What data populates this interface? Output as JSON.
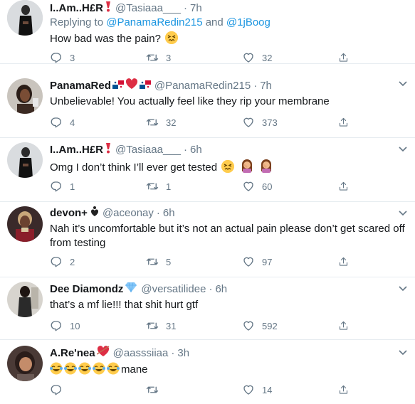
{
  "tweets": [
    {
      "name": "I..Am..H£R",
      "handle": "@Tasiaaa___",
      "time": "7h",
      "reply_prefix": "Replying to ",
      "reply_user1": "@PanamaRedin215",
      "reply_and": " and ",
      "reply_user2": "@1jBoog",
      "text": "How bad was the pain? ",
      "replies": "3",
      "retweets": "3",
      "likes": "32"
    },
    {
      "name": "PanamaRed",
      "handle": "@PanamaRedin215",
      "time": "7h",
      "text": "Unbelievable! You actually feel like they rip your membrane",
      "replies": "4",
      "retweets": "32",
      "likes": "373"
    },
    {
      "name": "I..Am..H£R",
      "handle": "@Tasiaaa___",
      "time": "6h",
      "text": "Omg I don’t think I’ll ever get tested ",
      "replies": "1",
      "retweets": "1",
      "likes": "60"
    },
    {
      "name": "devon+",
      "handle": "@aceonay",
      "time": "6h",
      "text": "Nah it’s uncomfortable but it’s not an actual pain please don’t get scared off from testing",
      "replies": "2",
      "retweets": "5",
      "likes": "97"
    },
    {
      "name": "Dee Diamondz",
      "handle": "@versatilidee",
      "time": "6h",
      "text": "that’s a mf lie!!! that shit hurt gtf",
      "replies": "10",
      "retweets": "31",
      "likes": "592"
    },
    {
      "name": "A.Re'nea",
      "handle": "@aasssiiaa",
      "time": "3h",
      "text": "mane",
      "replies": "",
      "retweets": "",
      "likes": "14"
    }
  ],
  "dot": "·"
}
